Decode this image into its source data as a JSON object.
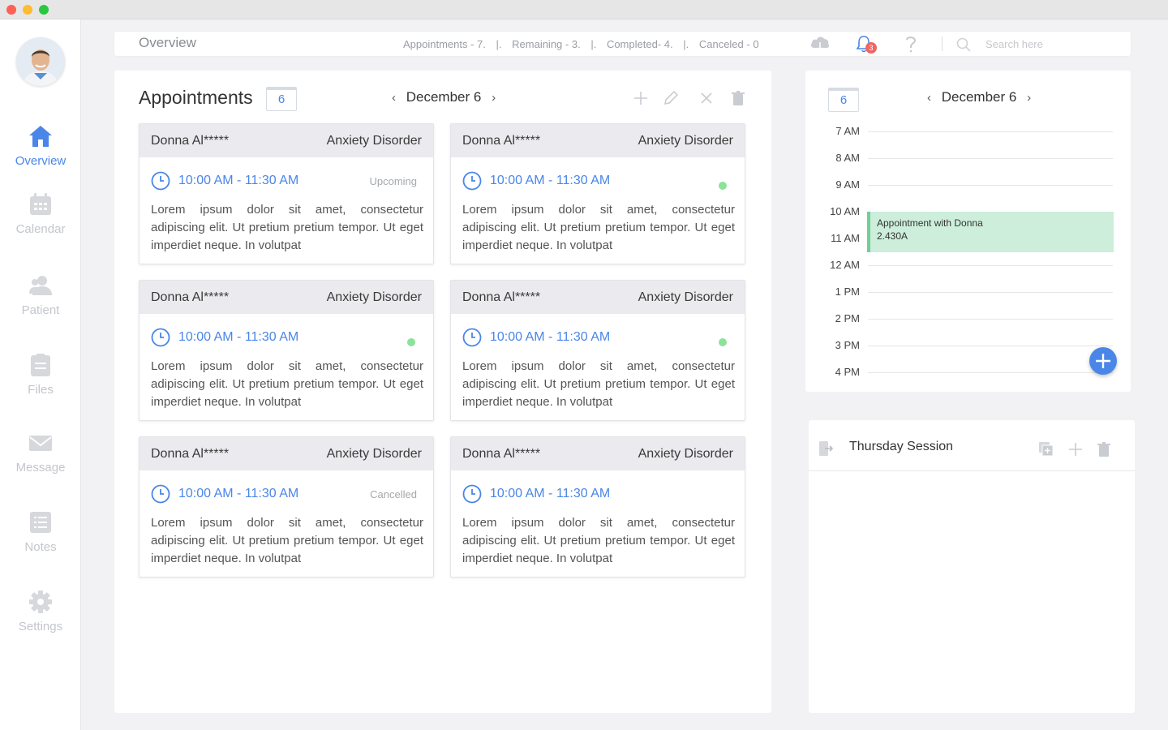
{
  "window": {
    "controls": [
      "close",
      "minimize",
      "maximize"
    ]
  },
  "sidebar": {
    "avatar_icon": "user-avatar",
    "items": [
      {
        "label": "Overview",
        "icon": "home-icon",
        "active": true
      },
      {
        "label": "Calendar",
        "icon": "calendar-icon",
        "active": false
      },
      {
        "label": "Patient",
        "icon": "patient-icon",
        "active": false
      },
      {
        "label": "Files",
        "icon": "files-icon",
        "active": false
      },
      {
        "label": "Message",
        "icon": "message-icon",
        "active": false
      },
      {
        "label": "Notes",
        "icon": "notes-icon",
        "active": false
      },
      {
        "label": "Settings",
        "icon": "gear-icon",
        "active": false
      }
    ]
  },
  "header": {
    "title": "Overview",
    "stats": {
      "appointments": "Appointments - 7.",
      "remaining": "Remaining - 3.",
      "completed": "Completed- 4.",
      "canceled": "Canceled - 0",
      "separator": "|."
    },
    "notification_count": "3",
    "search_placeholder": "Search here"
  },
  "appointments": {
    "title": "Appointments",
    "day_badge": "6",
    "date": "December 6",
    "cards": [
      {
        "name": "Donna Al*****",
        "condition": "Anxiety Disorder",
        "time": "10:00 AM - 11:30 AM",
        "status": "Upcoming",
        "dot": false,
        "description": "Lorem ipsum dolor sit amet, consectetur adipiscing elit. Ut pretium pretium tempor. Ut eget imperdiet neque. In volutpat"
      },
      {
        "name": "Donna Al*****",
        "condition": "Anxiety Disorder",
        "time": "10:00 AM - 11:30 AM",
        "status": "",
        "dot": true,
        "description": "Lorem ipsum dolor sit amet, consectetur adipiscing elit. Ut pretium pretium tempor. Ut eget imperdiet neque. In volutpat"
      },
      {
        "name": "Donna Al*****",
        "condition": "Anxiety Disorder",
        "time": "10:00 AM - 11:30 AM",
        "status": "",
        "dot": true,
        "description": "Lorem ipsum dolor sit amet, consectetur adipiscing elit. Ut pretium pretium tempor. Ut eget imperdiet neque. In volutpat"
      },
      {
        "name": "Donna Al*****",
        "condition": "Anxiety Disorder",
        "time": "10:00 AM - 11:30 AM",
        "status": "",
        "dot": true,
        "description": "Lorem ipsum dolor sit amet, consectetur adipiscing elit. Ut pretium pretium tempor. Ut eget imperdiet neque. In volutpat"
      },
      {
        "name": "Donna Al*****",
        "condition": "Anxiety Disorder",
        "time": "10:00 AM - 11:30 AM",
        "status": "Cancelled",
        "dot": false,
        "description": "Lorem ipsum dolor sit amet, consectetur adipiscing elit. Ut pretium pretium tempor. Ut eget imperdiet neque. In volutpat"
      },
      {
        "name": "Donna Al*****",
        "condition": "Anxiety Disorder",
        "time": "10:00 AM - 11:30 AM",
        "status": "",
        "dot": false,
        "description": "Lorem ipsum dolor sit amet, consectetur adipiscing elit. Ut pretium pretium tempor. Ut eget imperdiet neque. In volutpat"
      }
    ]
  },
  "schedule": {
    "day_badge": "6",
    "date": "December 6",
    "hours": [
      "7 AM",
      "8 AM",
      "9 AM",
      "10 AM",
      "11 AM",
      "12 AM",
      "1 PM",
      "2 PM",
      "3 PM",
      "4 PM"
    ],
    "event": {
      "title": "Appointment with Donna",
      "subtitle": "2.430A"
    }
  },
  "session": {
    "title": "Thursday Session"
  },
  "colors": {
    "accent": "#4a86e8",
    "status_dot": "#8be39a",
    "event_bg": "#cdeedb",
    "event_border": "#6fcf97",
    "badge": "#f06565"
  }
}
